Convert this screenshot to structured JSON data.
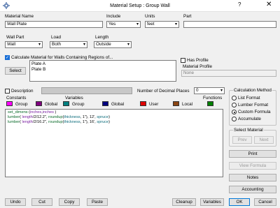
{
  "window": {
    "title": "Material Setup :  Group  Wall",
    "help_glyph": "?",
    "close_glyph": "✕"
  },
  "labels": {
    "material_name": "Material Name",
    "include": "Include",
    "units": "Units",
    "part": "Part",
    "wall_part": "Wall Part",
    "load": "Load",
    "length": "Length",
    "calc_regions": "Calculate Material for Walls Containing Regions of...",
    "has_profile": "Has Profile",
    "material_profile": "Material Profile",
    "description": "Description",
    "decimal_places": "Number of Decimal Places",
    "constants": "Constants",
    "variables": "Variables",
    "functions": "Functions",
    "calc_method": "Calculation Method",
    "select_material": "Select Material"
  },
  "fields": {
    "material_name": "Wall Plate",
    "include": "Yes",
    "units": "feet",
    "part": "",
    "wall_part": "Wall",
    "load": "Both",
    "length": "Outside",
    "material_profile_placeholder": "None",
    "decimal_places": "0",
    "description": ""
  },
  "checkboxes": {
    "calc_regions": true,
    "has_profile": false,
    "description": false
  },
  "regions": [
    "Plate A",
    "Plate B"
  ],
  "legend": [
    {
      "label": "Group",
      "color": "#ff00ff"
    },
    {
      "label": "Global",
      "color": "#800080"
    },
    {
      "label": "Group",
      "color": "#008080"
    },
    {
      "label": "Global",
      "color": "#000080"
    },
    {
      "label": "User",
      "color": "#e00000"
    },
    {
      "label": "Local",
      "color": "#8b4513"
    },
    {
      "label": "",
      "color": "#008000"
    }
  ],
  "formula_lines": [
    [
      {
        "t": "set_dimens",
        "c": "fn"
      },
      {
        "t": " ("
      },
      {
        "t": "inches",
        "c": "kw"
      },
      {
        "t": ","
      },
      {
        "t": "inches",
        "c": "kw"
      },
      {
        "t": " )"
      }
    ],
    [
      {
        "t": "lumber",
        "c": "fn"
      },
      {
        "t": "( "
      },
      {
        "t": "length",
        "c": "kw"
      },
      {
        "t": "/2/12.2\", "
      },
      {
        "t": "roundup",
        "c": "fn"
      },
      {
        "t": "("
      },
      {
        "t": "thickness",
        "c": "grp"
      },
      {
        "t": ", 1\"), 12', "
      },
      {
        "t": "spruce",
        "c": "grp"
      },
      {
        "t": ")"
      }
    ],
    [
      {
        "t": "lumber",
        "c": "fn"
      },
      {
        "t": "( "
      },
      {
        "t": "length",
        "c": "kw"
      },
      {
        "t": "/2/16.2\", "
      },
      {
        "t": "roundup",
        "c": "fn"
      },
      {
        "t": "("
      },
      {
        "t": "thickness",
        "c": "grp"
      },
      {
        "t": ", 1\"), 16', "
      },
      {
        "t": "spruce",
        "c": "grp"
      },
      {
        "t": ")"
      }
    ]
  ],
  "calc_methods": [
    {
      "label": "List Format",
      "selected": false
    },
    {
      "label": "Lumber Format",
      "selected": false
    },
    {
      "label": "Custom Formula",
      "selected": true
    },
    {
      "label": "Accumulate",
      "selected": false
    }
  ],
  "buttons": {
    "select": "Select",
    "prev": "Prev",
    "next": "Next",
    "print": "Print",
    "view_formula": "View Formula",
    "notes": "Notes",
    "accounting": "Accounting",
    "ok": "OK",
    "cancel": "Cancel",
    "undo": "Undo",
    "cut": "Cut",
    "copy": "Copy",
    "paste": "Paste",
    "cleanup": "Cleanup",
    "variables": "Variables"
  },
  "icons": {
    "app": "gear-icon",
    "chevron": "▾"
  }
}
